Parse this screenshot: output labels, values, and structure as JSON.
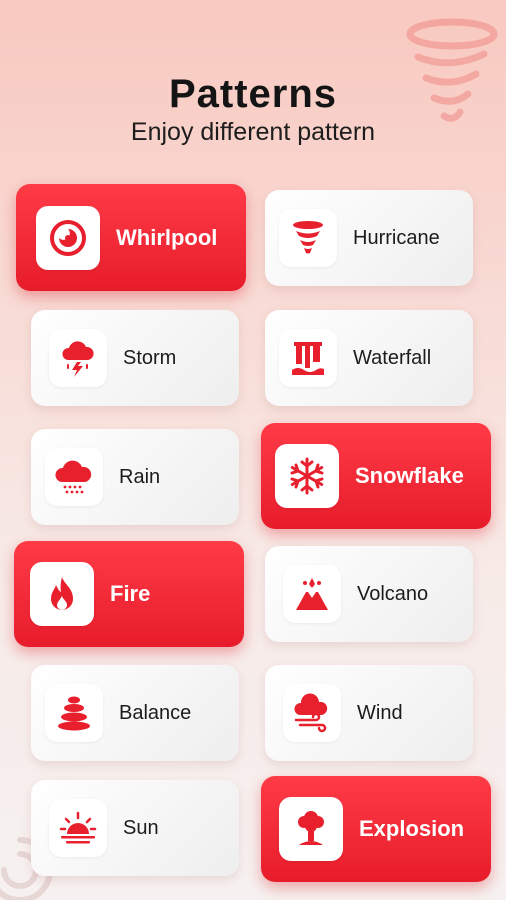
{
  "header": {
    "title": "Patterns",
    "subtitle": "Enjoy different pattern"
  },
  "patterns": [
    {
      "label": "Whirlpool",
      "icon": "whirlpool-icon",
      "selected": true
    },
    {
      "label": "Hurricane",
      "icon": "hurricane-icon",
      "selected": false
    },
    {
      "label": "Storm",
      "icon": "storm-icon",
      "selected": false
    },
    {
      "label": "Waterfall",
      "icon": "waterfall-icon",
      "selected": false
    },
    {
      "label": "Rain",
      "icon": "rain-icon",
      "selected": false
    },
    {
      "label": "Snowflake",
      "icon": "snowflake-icon",
      "selected": true
    },
    {
      "label": "Fire",
      "icon": "fire-icon",
      "selected": true
    },
    {
      "label": "Volcano",
      "icon": "volcano-icon",
      "selected": false
    },
    {
      "label": "Balance",
      "icon": "balance-stones-icon",
      "selected": false
    },
    {
      "label": "Wind",
      "icon": "wind-icon",
      "selected": false
    },
    {
      "label": "Sun",
      "icon": "sun-icon",
      "selected": false
    },
    {
      "label": "Explosion",
      "icon": "explosion-icon",
      "selected": true
    }
  ],
  "colors": {
    "accent": "#ef2533",
    "accent_light": "#ff3b47",
    "card_bg": "#f4f3f3",
    "text": "#1c1c1c"
  }
}
